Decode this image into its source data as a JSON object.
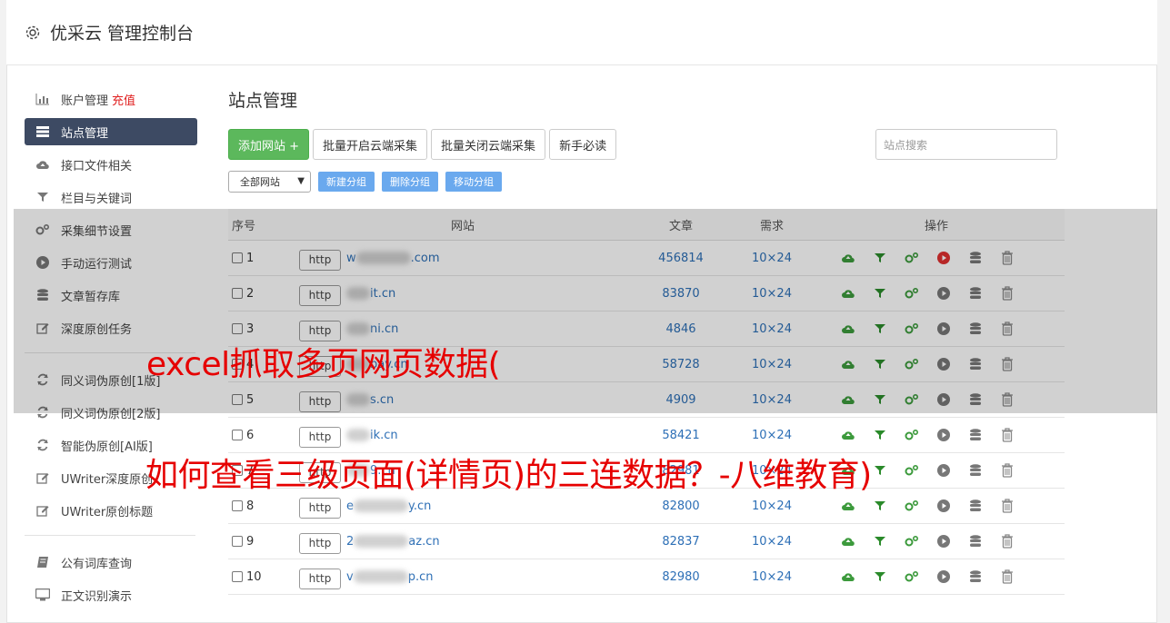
{
  "app": {
    "title": "优采云 管理控制台"
  },
  "sidebar": {
    "items": [
      {
        "label": "账户管理",
        "extra": "充值",
        "icon": "bar-chart-icon"
      },
      {
        "label": "站点管理",
        "icon": "server-icon",
        "active": true
      },
      {
        "label": "接口文件相关",
        "icon": "cloud-upload-icon"
      },
      {
        "label": "栏目与关键词",
        "icon": "filter-icon"
      },
      {
        "label": "采集细节设置",
        "icon": "gears-icon"
      },
      {
        "label": "手动运行测试",
        "icon": "play-circle-icon"
      },
      {
        "label": "文章暂存库",
        "icon": "database-icon"
      },
      {
        "label": "深度原创任务",
        "icon": "edit-icon"
      }
    ],
    "items2": [
      {
        "label": "同义词伪原创[1版]",
        "icon": "refresh-icon"
      },
      {
        "label": "同义词伪原创[2版]",
        "icon": "refresh-icon"
      },
      {
        "label": "智能伪原创[AI版]",
        "icon": "refresh-icon"
      },
      {
        "label": "UWriter深度原创",
        "icon": "edit-icon"
      },
      {
        "label": "UWriter原创标题",
        "icon": "edit-icon"
      }
    ],
    "items3": [
      {
        "label": "公有词库查询",
        "icon": "book-icon"
      },
      {
        "label": "正文识别演示",
        "icon": "monitor-icon"
      }
    ]
  },
  "main": {
    "title": "站点管理",
    "toolbar": {
      "add_site": "添加网站 +",
      "batch_on": "批量开启云端采集",
      "batch_off": "批量关闭云端采集",
      "guide": "新手必读"
    },
    "search_placeholder": "站点搜索",
    "group_select": "全部网站",
    "group_buttons": {
      "new": "新建分组",
      "delete": "删除分组",
      "move": "移动分组"
    },
    "table": {
      "headers": {
        "no": "序号",
        "site": "网站",
        "articles": "文章",
        "demand": "需求",
        "ops": "操作"
      },
      "rows": [
        {
          "no": "1",
          "prefix": "w",
          "tail": ".com",
          "articles": "456814",
          "demand": "10×24",
          "active_play": true
        },
        {
          "no": "2",
          "prefix": "",
          "tail": "it.cn",
          "articles": "83870",
          "demand": "10×24"
        },
        {
          "no": "3",
          "prefix": "",
          "tail": "ni.cn",
          "articles": "4846",
          "demand": "10×24"
        },
        {
          "no": "4",
          "prefix": "",
          "tail": "bay.cn",
          "articles": "58728",
          "demand": "10×24"
        },
        {
          "no": "5",
          "prefix": "",
          "tail": "s.cn",
          "articles": "4909",
          "demand": "10×24"
        },
        {
          "no": "6",
          "prefix": "",
          "tail": "ik.cn",
          "articles": "58421",
          "demand": "10×24"
        },
        {
          "no": "7",
          "prefix": "",
          "tail": "9.cn",
          "articles": "82981",
          "demand": "10×24"
        },
        {
          "no": "8",
          "prefix": "e",
          "tail": "y.cn",
          "articles": "82800",
          "demand": "10×24"
        },
        {
          "no": "9",
          "prefix": "2",
          "tail": "az.cn",
          "articles": "82837",
          "demand": "10×24"
        },
        {
          "no": "10",
          "prefix": "v",
          "tail": "p.cn",
          "articles": "82980",
          "demand": "10×24"
        }
      ],
      "http_label": "http"
    }
  },
  "watermark": {
    "line1": "excel抓取多页网页数据(",
    "line2": "如何查看三级页面(详情页)的三连数据？-八维教育)"
  },
  "colors": {
    "accent_green": "#5cb85c",
    "sidebar_active": "#3d4a63",
    "link_blue": "#2d6fb6",
    "watermark_red": "#e60000"
  }
}
